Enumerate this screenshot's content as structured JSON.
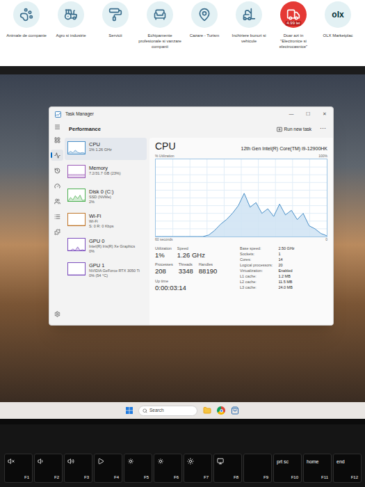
{
  "categories": [
    {
      "label": "Animale de companie",
      "kind": "pets"
    },
    {
      "label": "Agro si industrie",
      "kind": "agro"
    },
    {
      "label": "Servicii",
      "kind": "services"
    },
    {
      "label": "Echipamente profesionale si vanzare companii",
      "kind": "equipment"
    },
    {
      "label": "Cazare - Turism",
      "kind": "travel"
    },
    {
      "label": "Inchiriere bunuri si vehicule",
      "kind": "rental"
    },
    {
      "label": "Doar azi in \"Electronice si electrocasnice\"",
      "kind": "deal",
      "badge": "4.99 lei"
    },
    {
      "label": "OLX Marketplac",
      "kind": "logo",
      "logo": "olx"
    }
  ],
  "window": {
    "title": "Task Manager",
    "controls": [
      "—",
      "☐",
      "✕"
    ]
  },
  "nav": [
    {
      "kind": "processes",
      "selected": false
    },
    {
      "kind": "performance",
      "selected": true
    },
    {
      "kind": "history",
      "selected": false
    },
    {
      "kind": "startup",
      "selected": false
    },
    {
      "kind": "users",
      "selected": false
    },
    {
      "kind": "details",
      "selected": false
    },
    {
      "kind": "services",
      "selected": false
    }
  ],
  "nav_bottom": {
    "kind": "settings",
    "selected": false
  },
  "header": {
    "title": "Performance",
    "run_new_task": "Run new task",
    "more": "⋯"
  },
  "resources": [
    {
      "name": "CPU",
      "lines": [
        "1% 1.26 GHz"
      ],
      "selected": true,
      "color": "#4a90c8",
      "graph": [
        5,
        20,
        8,
        30,
        12,
        6,
        10,
        4
      ]
    },
    {
      "name": "Memory",
      "lines": [
        "7.2/31.7 GB (23%)"
      ],
      "selected": false,
      "color": "#9b59b6",
      "graph": [
        23,
        23,
        23,
        23,
        23,
        23,
        23,
        23
      ]
    },
    {
      "name": "Disk 0 (C:)",
      "lines": [
        "SSD (NVMe)",
        "2%"
      ],
      "selected": false,
      "color": "#4caf50",
      "graph": [
        0,
        30,
        10,
        45,
        20,
        50,
        5,
        10
      ]
    },
    {
      "name": "Wi-Fi",
      "lines": [
        "Wi-Fi",
        "S: 0 R: 0 Kbps"
      ],
      "selected": false,
      "color": "#c0762a",
      "graph": [
        0,
        0,
        0,
        0,
        0,
        0,
        0,
        0
      ]
    },
    {
      "name": "GPU 0",
      "lines": [
        "Intel(R) Iris(R) Xe Graphics",
        "0%"
      ],
      "selected": false,
      "color": "#7c4dbd",
      "graph": [
        0,
        0,
        12,
        0,
        30,
        0,
        6,
        0
      ]
    },
    {
      "name": "GPU 1",
      "lines": [
        "NVIDIA GeForce RTX 3050 Ti",
        "0% (54 °C)"
      ],
      "selected": false,
      "color": "#7c4dbd",
      "graph": [
        0,
        0,
        0,
        0,
        0,
        0,
        0,
        0
      ]
    }
  ],
  "detail": {
    "title": "CPU",
    "model": "12th Gen Intel(R) Core(TM) i9-12900HK",
    "axis_label": "% Utilization",
    "axis_max": "100%",
    "axis_time": "60 seconds",
    "axis_min": "0",
    "series": [
      0,
      0,
      0,
      0,
      0,
      0,
      0,
      0,
      0,
      2,
      8,
      16,
      22,
      30,
      40,
      56,
      38,
      44,
      30,
      36,
      26,
      42,
      28,
      34,
      22,
      30,
      14,
      10,
      4,
      1
    ]
  },
  "stats": [
    [
      {
        "label": "Utilization",
        "value": "1%"
      },
      {
        "label": "Speed",
        "value": "1.26 GHz"
      }
    ],
    [
      {
        "label": "Processes",
        "value": "208"
      },
      {
        "label": "Threads",
        "value": "3348"
      },
      {
        "label": "Handles",
        "value": "88190"
      }
    ],
    [
      {
        "label": "Up time",
        "value": "0:00:03:14"
      }
    ]
  ],
  "specs": [
    {
      "label": "Base speed:",
      "value": "2.50 GHz"
    },
    {
      "label": "Sockets:",
      "value": "1"
    },
    {
      "label": "Cores:",
      "value": "14"
    },
    {
      "label": "Logical processors:",
      "value": "20"
    },
    {
      "label": "Virtualization:",
      "value": "Enabled"
    },
    {
      "label": "L1 cache:",
      "value": "1.2 MB"
    },
    {
      "label": "L2 cache:",
      "value": "11.5 MB"
    },
    {
      "label": "L3 cache:",
      "value": "24.0 MB"
    }
  ],
  "taskbar": {
    "search": "Search",
    "apps": [
      {
        "kind": "folder"
      },
      {
        "kind": "chrome"
      },
      {
        "kind": "store"
      }
    ]
  },
  "keys": [
    {
      "label": "F1",
      "kind": "mute"
    },
    {
      "label": "F2",
      "kind": "vol-down"
    },
    {
      "label": "F3",
      "kind": "vol-up"
    },
    {
      "label": "F4",
      "kind": "play-pause"
    },
    {
      "label": "F5",
      "kind": "brightness-down"
    },
    {
      "label": "F6",
      "kind": "brightness-up"
    },
    {
      "label": "F7",
      "kind": "sun"
    },
    {
      "label": "F8",
      "kind": "display"
    },
    {
      "label": "F9",
      "kind": "none"
    },
    {
      "label": "F10",
      "kind": "text",
      "top": "prt sc"
    },
    {
      "label": "F11",
      "kind": "text",
      "top": "home"
    },
    {
      "label": "F12",
      "kind": "text",
      "top": "end"
    }
  ]
}
